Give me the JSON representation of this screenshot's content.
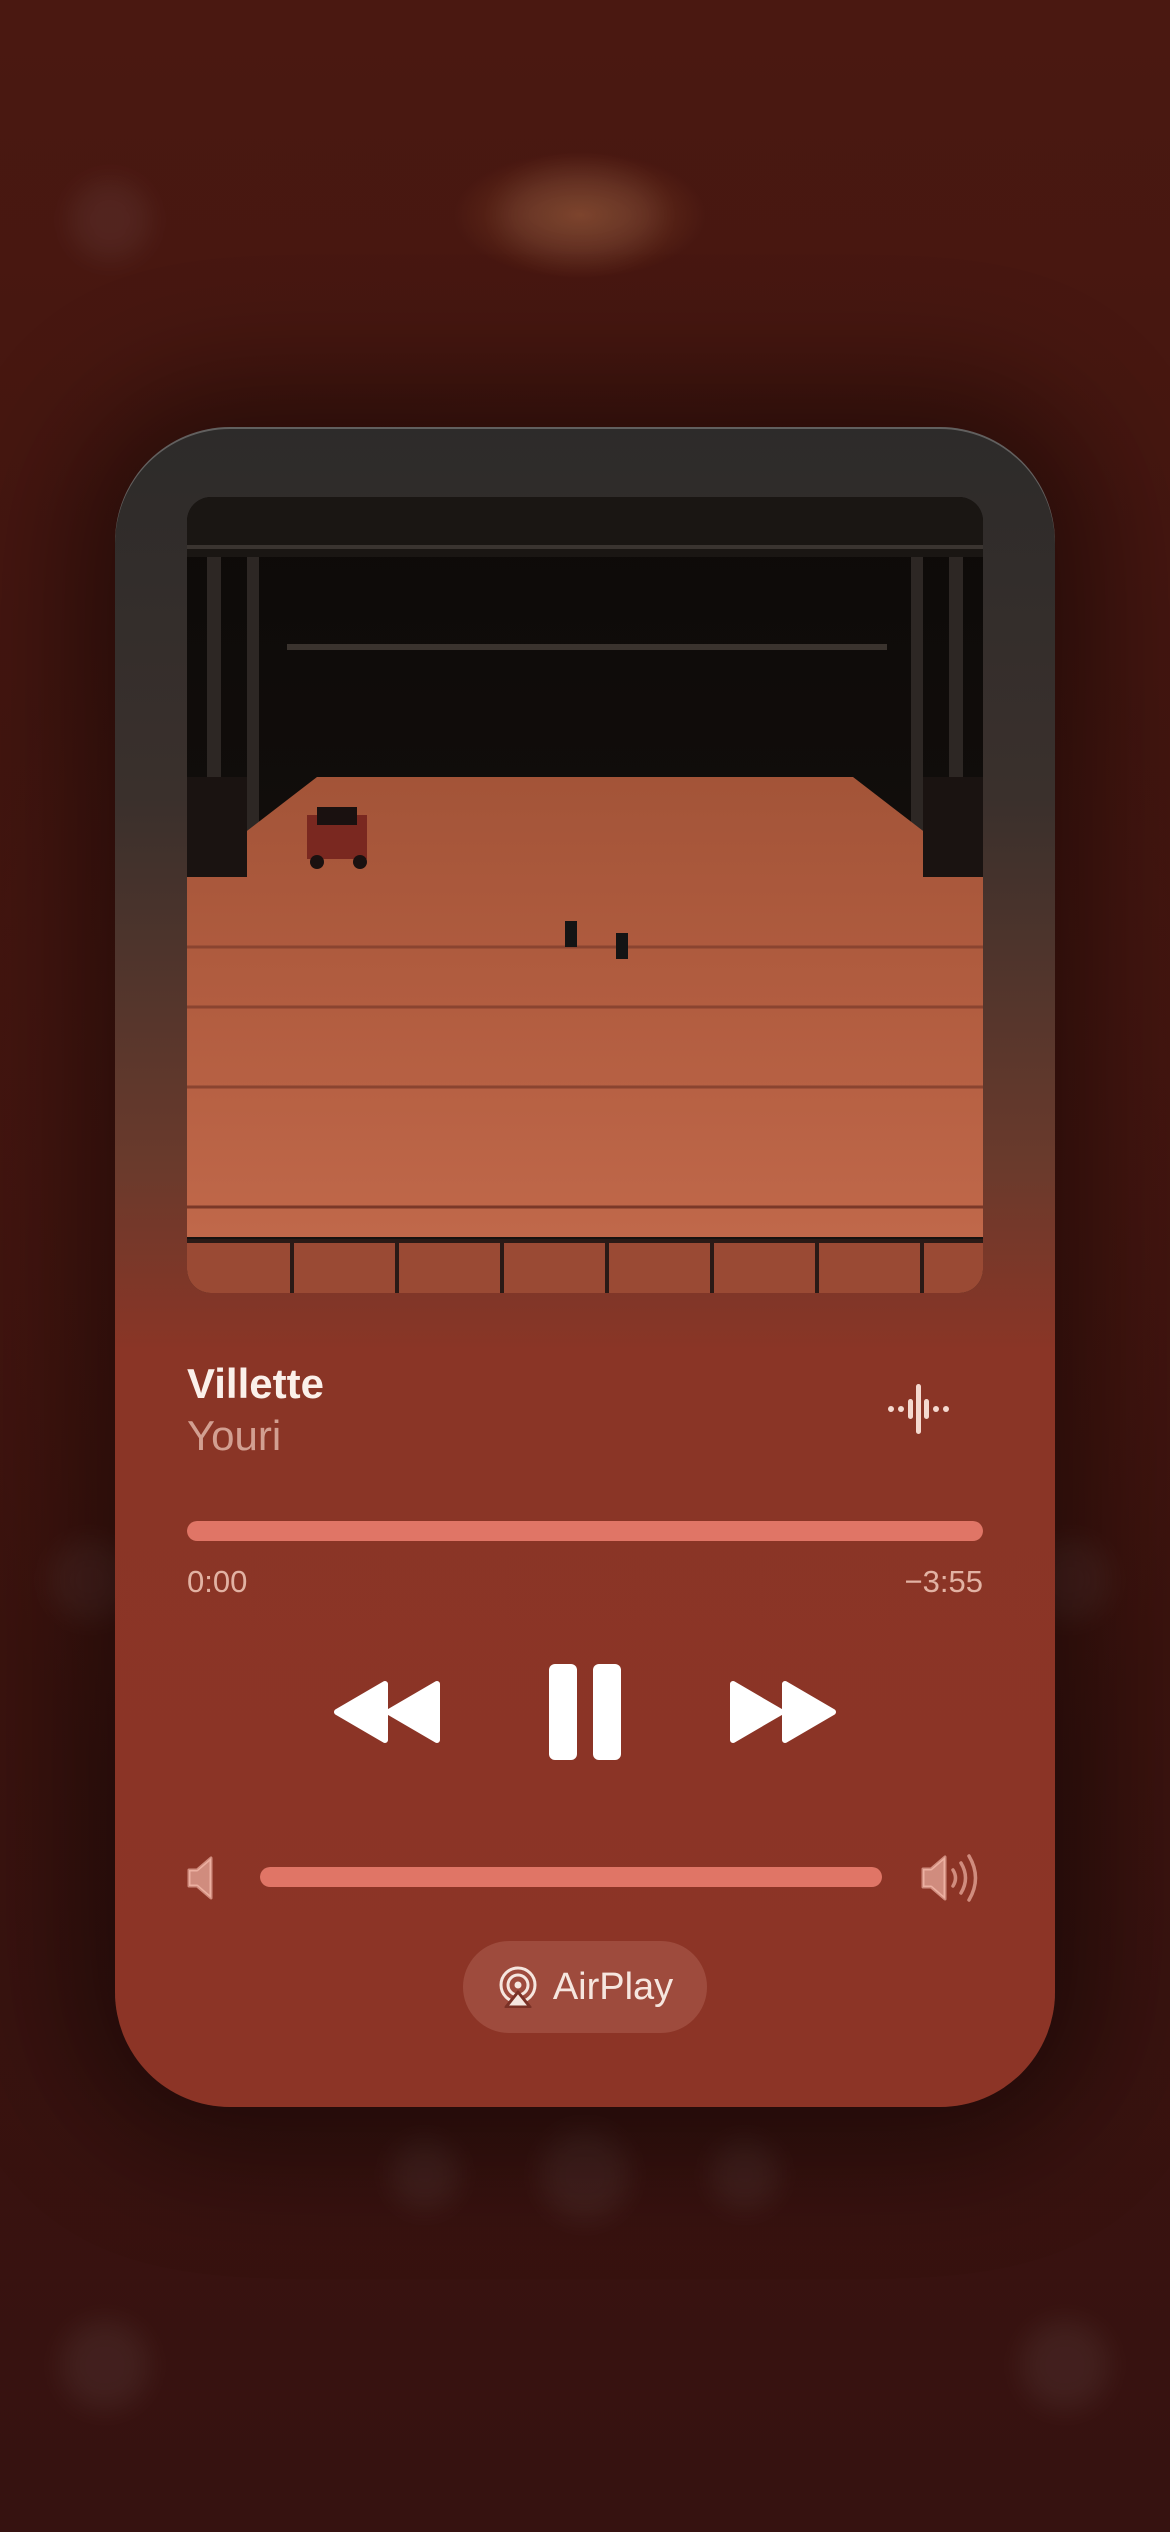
{
  "now_playing": {
    "title": "Villette",
    "artist": "Youri",
    "elapsed": "0:00",
    "remaining": "−3:55",
    "progress": 1.0,
    "volume": 1.0
  },
  "controls": {
    "rewind_icon": "backward-icon",
    "pause_icon": "pause-icon",
    "forward_icon": "forward-icon",
    "waveform_icon": "waveform-icon",
    "volume_low_icon": "speaker-low-icon",
    "volume_high_icon": "speaker-high-icon"
  },
  "airplay": {
    "label": "AirPlay",
    "icon": "airplay-icon"
  },
  "colors": {
    "accent": "#e07566",
    "card_bottom": "#8c3426",
    "background": "#431510"
  }
}
